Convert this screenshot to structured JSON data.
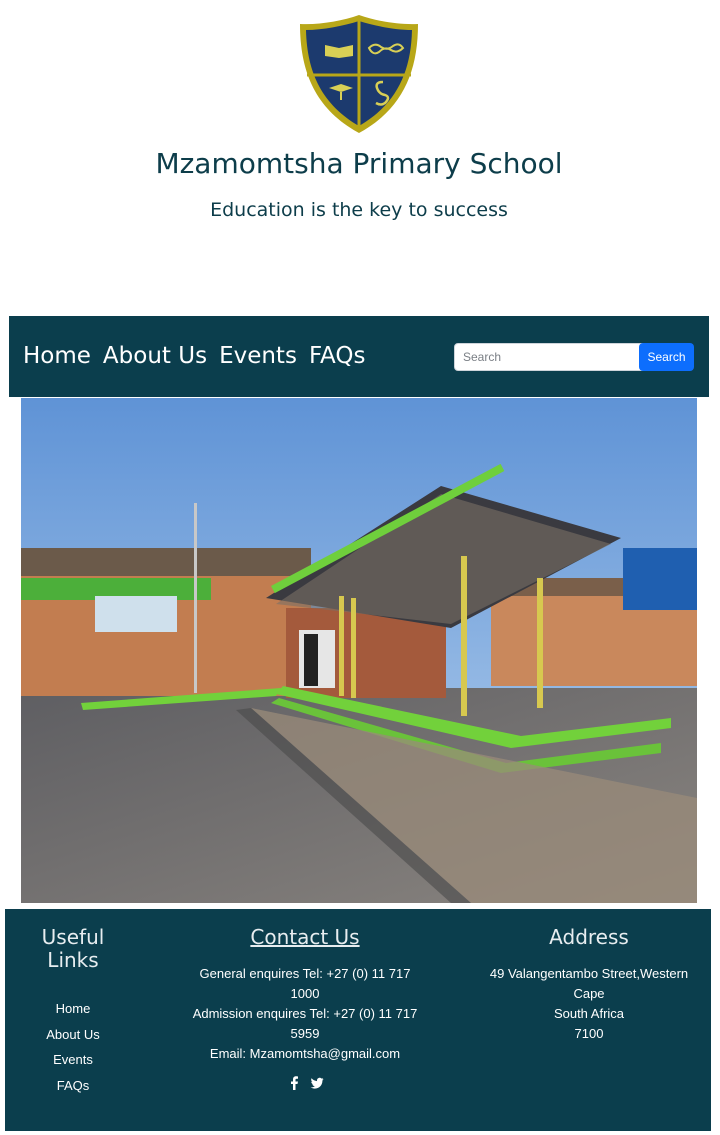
{
  "header": {
    "school_name": "Mzamomtsha Primary School",
    "tagline": "Education is the key to success"
  },
  "nav": {
    "links": [
      {
        "label": "Home"
      },
      {
        "label": "About Us"
      },
      {
        "label": "Events"
      },
      {
        "label": "FAQs"
      }
    ],
    "search_placeholder": "Search",
    "search_button": "Search"
  },
  "footer": {
    "useful_links": {
      "heading_line1": "Useful",
      "heading_line2": "Links",
      "items": [
        "Home",
        "About Us",
        "Events",
        "FAQs"
      ]
    },
    "contact": {
      "heading": "Contact Us",
      "general_line1": "General enquires Tel: +27 (0) 11 717",
      "general_line2": "1000",
      "admission_line1": "Admission enquires Tel: +27 (0) 11 717",
      "admission_line2": "5959",
      "email": "Email: Mzamomtsha@gmail.com",
      "social_icons": [
        "facebook-icon",
        "twitter-icon"
      ]
    },
    "address": {
      "heading": "Address",
      "line1": "49 Valangentambo Street,Western",
      "line2": "Cape",
      "line3": "South Africa",
      "line4": "7100"
    }
  },
  "colors": {
    "brand_dark_teal": "#0b3e4d",
    "button_blue": "#0d6efd",
    "crest_navy": "#1c3a6e",
    "crest_gold": "#b8a718"
  }
}
